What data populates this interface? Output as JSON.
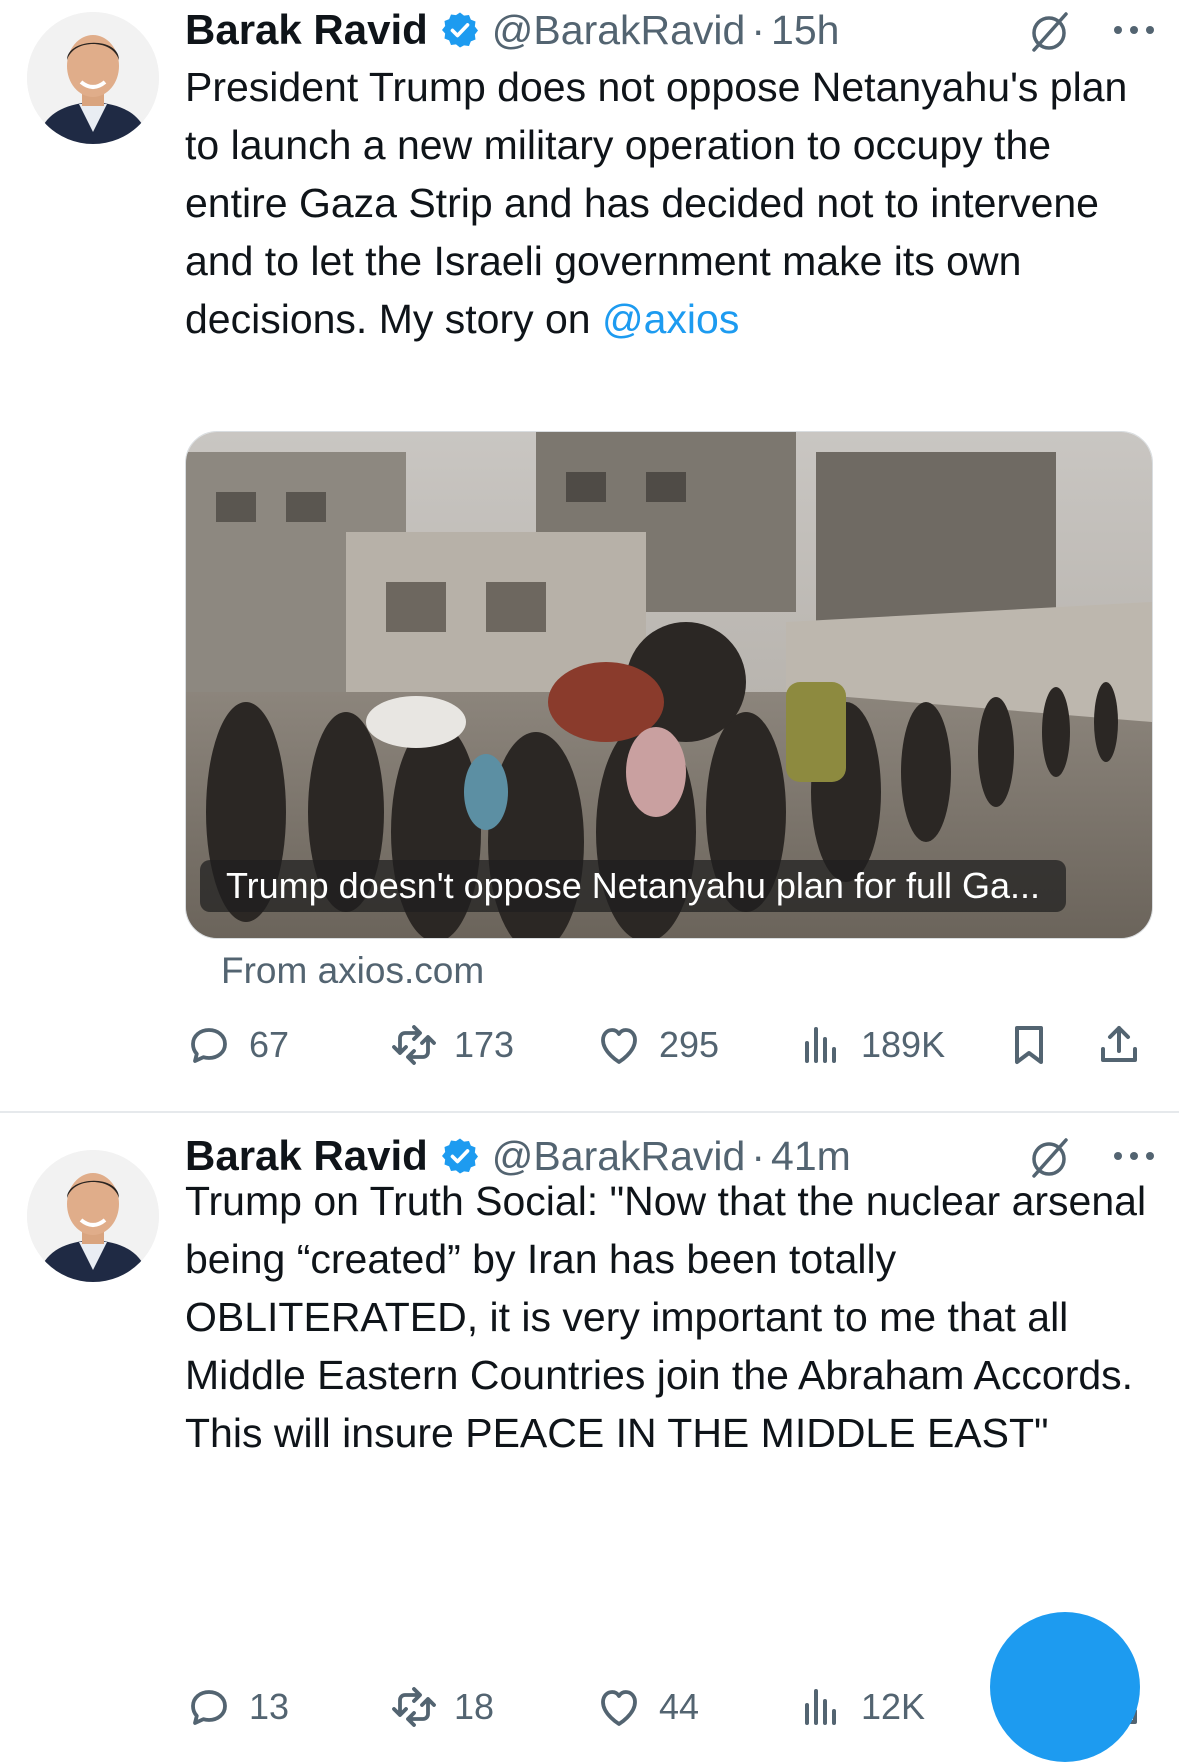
{
  "tweets": [
    {
      "author_name": "Barak Ravid",
      "handle": "@BarakRavid",
      "separator": "·",
      "time": "15h",
      "text_main": "President Trump does not oppose Netanyahu's plan to launch a new military operation to occupy the entire Gaza Strip and has decided not to intervene and to let the Israeli government make its own decisions. My story on ",
      "text_mention": "@axios",
      "card": {
        "caption": "Trump doesn't oppose Netanyahu plan for full Ga...",
        "source": "From axios.com"
      },
      "actions": {
        "replies": "67",
        "reposts": "173",
        "likes": "295",
        "views": "189K"
      }
    },
    {
      "author_name": "Barak Ravid",
      "handle": "@BarakRavid",
      "separator": "·",
      "time": "41m",
      "text_main": "Trump on Truth Social: \"Now that the nuclear arsenal being “created” by Iran has been totally OBLITERATED, it is very important to me that all Middle Eastern Countries join the Abraham Accords. This will insure PEACE IN THE MIDDLE EAST\"",
      "actions": {
        "replies": "13",
        "reposts": "18",
        "likes": "44",
        "views": "12K"
      }
    }
  ],
  "icons": {
    "verified": "verified-badge-icon",
    "grok": "grok-icon",
    "more": "more-icon",
    "reply": "reply-icon",
    "repost": "repost-icon",
    "like": "like-icon",
    "views": "views-icon",
    "bookmark": "bookmark-icon",
    "share": "share-icon"
  },
  "colors": {
    "accent": "#1d9bf0",
    "text": "#0f1419",
    "secondary": "#536471"
  }
}
